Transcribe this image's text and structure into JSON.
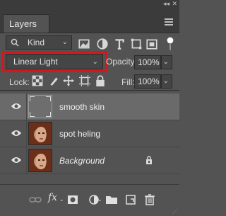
{
  "panel": {
    "tab_title": "Layers",
    "colors": {
      "panel_bg": "#535353",
      "highlight_box": "#d1181f",
      "selected_row": "#6a6a6a"
    }
  },
  "filter": {
    "kind_label": "Kind",
    "icons": [
      "image-filter-icon",
      "adjustment-filter-icon",
      "type-filter-icon",
      "shape-filter-icon",
      "smart-object-filter-icon",
      "filter-toggle-dot"
    ]
  },
  "blend": {
    "mode": "Linear Light",
    "opacity_label": "Opacity:",
    "opacity_value": "100%"
  },
  "lock": {
    "label": "Lock:",
    "fill_label": "Fill:",
    "fill_value": "100%",
    "icons": [
      "lock-transparent-pixels-icon",
      "lock-image-pixels-icon",
      "lock-position-icon",
      "lock-artboard-icon",
      "lock-all-icon"
    ]
  },
  "layers": [
    {
      "name": "smooth skin",
      "selected": true,
      "thumbnail": "empty",
      "italic": false,
      "locked": false
    },
    {
      "name": "spot heling",
      "selected": false,
      "thumbnail": "photo",
      "italic": false,
      "locked": false
    },
    {
      "name": "Background",
      "selected": false,
      "thumbnail": "photo",
      "italic": true,
      "locked": true
    }
  ],
  "bottom_toolbar": {
    "icons": [
      "link-layers-icon",
      "fx-icon",
      "add-mask-icon",
      "adjustment-layer-icon",
      "new-group-icon",
      "new-layer-icon",
      "delete-layer-icon"
    ],
    "fx_label": "fx"
  }
}
